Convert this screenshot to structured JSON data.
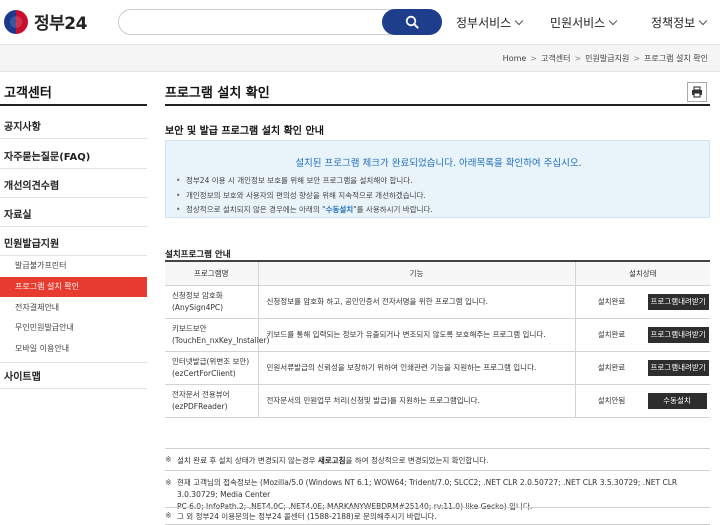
{
  "header": {
    "logo_text": "정부24",
    "search_placeholder": "",
    "nav": [
      "정부서비스",
      "민원서비스",
      "정책정보"
    ]
  },
  "breadcrumb": [
    "Home",
    "고객센터",
    "민원발급지원",
    "프로그램 설치 확인"
  ],
  "sidebar": {
    "title": "고객센터",
    "items": [
      "공지사항",
      "자주묻는질문(FAQ)",
      "개선의견수렴",
      "자료실",
      "민원발급지원",
      "사이트맵"
    ],
    "sub_items": [
      "발급불가프린터",
      "프로그램 설치 확인",
      "전자결제안내",
      "무인민원발급안내",
      "모바일 이용안내"
    ]
  },
  "main": {
    "title": "프로그램 설치 확인",
    "subtitle": "보안 및 발급 프로그램 설치 확인 안내",
    "notice": {
      "head": "설치된 프로그램 체크가 완료되었습니다. 아래목록을 확인하여 주십시오.",
      "l1": "정부24 이용 시 개인정보 보호를 위해 보안 프로그램을 설치해야 합니다.",
      "l2": "개인정보의 보호와 사용자의 편의성 향상을 위해 지속적으로 개선하겠습니다.",
      "l3_pre": "정상적으로 설치되지 않은 경우에는 아래의 \"",
      "l3_link": "수동설치",
      "l3_post": "\"를 사용하시기 바랍니다."
    },
    "table_title": "설치프로그램 안내",
    "columns": [
      "프로그램명",
      "기능",
      "설치상태"
    ],
    "rows": [
      {
        "name": "신청정보 암호화",
        "sub": "(AnySign4PC)",
        "desc": "신청정보를 암호화 하고, 공인인증서 전자서명을 위한 프로그램 입니다.",
        "status": "설치완료",
        "btn": "프로그램내려받기"
      },
      {
        "name": "키보드보안",
        "sub": "(TouchEn_nxKey_Installer)",
        "desc": "키보드를 통해 입력되는 정보가 유출되거나 변조되지 않도록 보호해주는 프로그램 입니다.",
        "status": "설치완료",
        "btn": "프로그램내려받기"
      },
      {
        "name": "인터넷발급(위변조 보안)",
        "sub": "(ezCertForClient)",
        "desc": "민원서류발급의 신뢰성을 보장하기 위하여 인쇄관련 기능을 지원하는 프로그램 입니다.",
        "status": "설치완료",
        "btn": "프로그램내려받기"
      },
      {
        "name": "전자문서 전용뷰어",
        "sub": "(ezPDFReader)",
        "desc": "전자문서의 민원업무 처리(신청및 발급)를 지원하는 프로그램입니다.",
        "status": "설치안됨",
        "btn": "수동설치"
      }
    ],
    "info": {
      "mark": "※",
      "n1_pre": "설치 완료 후 설치 상태가 변경되지 않는경우 ",
      "n1_bold": "새로고침",
      "n1_post": "을 하여 정상적으로 변경되었는지 확인합니다.",
      "n2_l1": "현재 고객님의 접속정보는 (Mozilla/5.0 (Windows NT 6.1; WOW64; Trident/7.0; SLCC2; .NET CLR 2.0.50727; .NET CLR 3.5.30729; .NET CLR 3.0.30729; Media Center",
      "n2_l2": "PC 6.0; InfoPath.2; .NET4.0C; .NET4.0E; MARKANYWEBDRM#25140; rv:11.0) like Gecko) 입니다.",
      "n3": "그 외 정부24 이용문의는 정부24 콜센터 (1588-2188)로 문의해주시기 바랍니다."
    }
  }
}
